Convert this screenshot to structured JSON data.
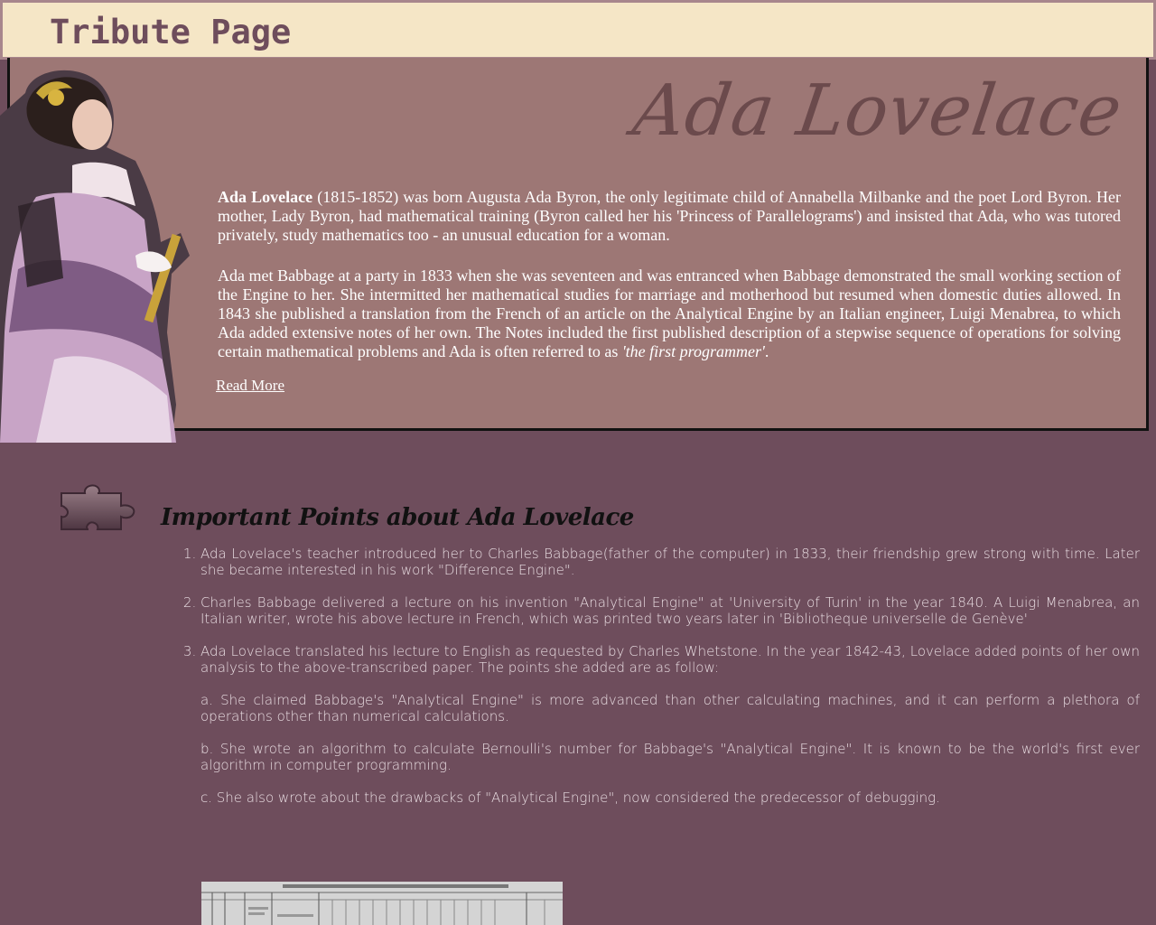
{
  "header": {
    "title": "Tribute Page"
  },
  "hero": {
    "name_heading": "Ada Lovelace",
    "para1": {
      "bold_name": "Ada Lovelace",
      "text": " (1815-1852) was born Augusta Ada Byron, the only legitimate child of Annabella Milbanke and the poet Lord Byron. Her mother, Lady Byron, had mathematical training (Byron called her his 'Princess of Parallelograms') and insisted that Ada, who was tutored privately, study mathematics too - an unusual education for a woman."
    },
    "para2": {
      "text": "Ada met Babbage at a party in 1833 when she was seventeen and was entranced when Babbage demonstrated the small working section of the Engine to her. She intermitted her mathematical studies for marriage and motherhood but resumed when domestic duties allowed. In 1843 she published a translation from the French of an article on the Analytical Engine by an Italian engineer, Luigi Menabrea, to which Ada added extensive notes of her own. The Notes included the first published description of a stepwise sequence of operations for solving certain mathematical problems and Ada is often referred to as ",
      "italic": "'the first programmer'",
      "end": "."
    },
    "read_more": "Read More"
  },
  "points": {
    "title": "Important Points about Ada Lovelace",
    "items": [
      "Ada Lovelace's teacher introduced her to Charles Babbage(father of the computer) in 1833, their friendship grew strong with time. Later she became interested in his work \"Difference Engine\".",
      "Charles Babbage delivered a lecture on his invention \"Analytical Engine\" at 'University of Turin' in the year 1840. A Luigi Menabrea, an Italian writer, wrote his above lecture in French, which was printed two years later in 'Bibliotheque universelle de Genève'",
      "Ada Lovelace translated his lecture to English as requested by Charles Whetstone. In the year 1842-43, Lovelace added points of her own analysis to the above-transcribed paper. The points she added are as follow:"
    ],
    "sub_items": [
      "a. She claimed Babbage's \"Analytical Engine\" is more advanced than other calculating machines, and it can perform a plethora of operations other than numerical calculations.",
      "b. She wrote an algorithm to calculate Bernoulli's number for Babbage's \"Analytical Engine\". It is known to be the world's first ever algorithm in computer programming.",
      "c. She also wrote about the drawbacks of \"Analytical Engine\", now considered the predecessor of debugging."
    ]
  },
  "icons": {
    "portrait": "ada-lovelace-portrait",
    "puzzle": "puzzle-piece-icon",
    "engine_diagram": "analytical-engine-diagram"
  },
  "colors": {
    "page_bg": "#6e4d5c",
    "header_bg": "#f5e6c6",
    "hero_bg": "#9d7775",
    "title_color": "#6e4d5c"
  }
}
